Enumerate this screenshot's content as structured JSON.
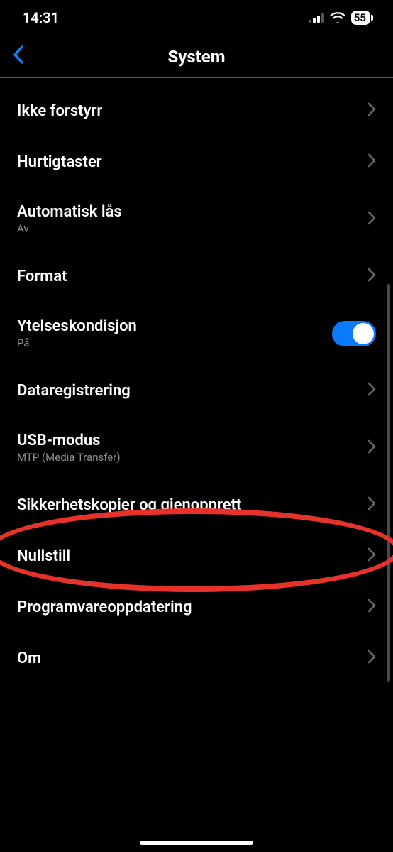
{
  "status": {
    "time": "14:31",
    "battery": "55"
  },
  "nav": {
    "title": "System"
  },
  "rows": {
    "dnd": {
      "label": "Ikke forstyrr"
    },
    "shortcuts": {
      "label": "Hurtigtaster"
    },
    "autolock": {
      "label": "Automatisk lås",
      "sub": "Av"
    },
    "format": {
      "label": "Format"
    },
    "perf": {
      "label": "Ytelseskondisjon",
      "sub": "På"
    },
    "datarec": {
      "label": "Dataregistrering"
    },
    "usb": {
      "label": "USB-modus",
      "sub": "MTP (Media Transfer)"
    },
    "backup": {
      "label": "Sikkerhetskopier og gjenopprett"
    },
    "reset": {
      "label": "Nullstill"
    },
    "update": {
      "label": "Programvareoppdatering"
    },
    "about": {
      "label": "Om"
    }
  }
}
